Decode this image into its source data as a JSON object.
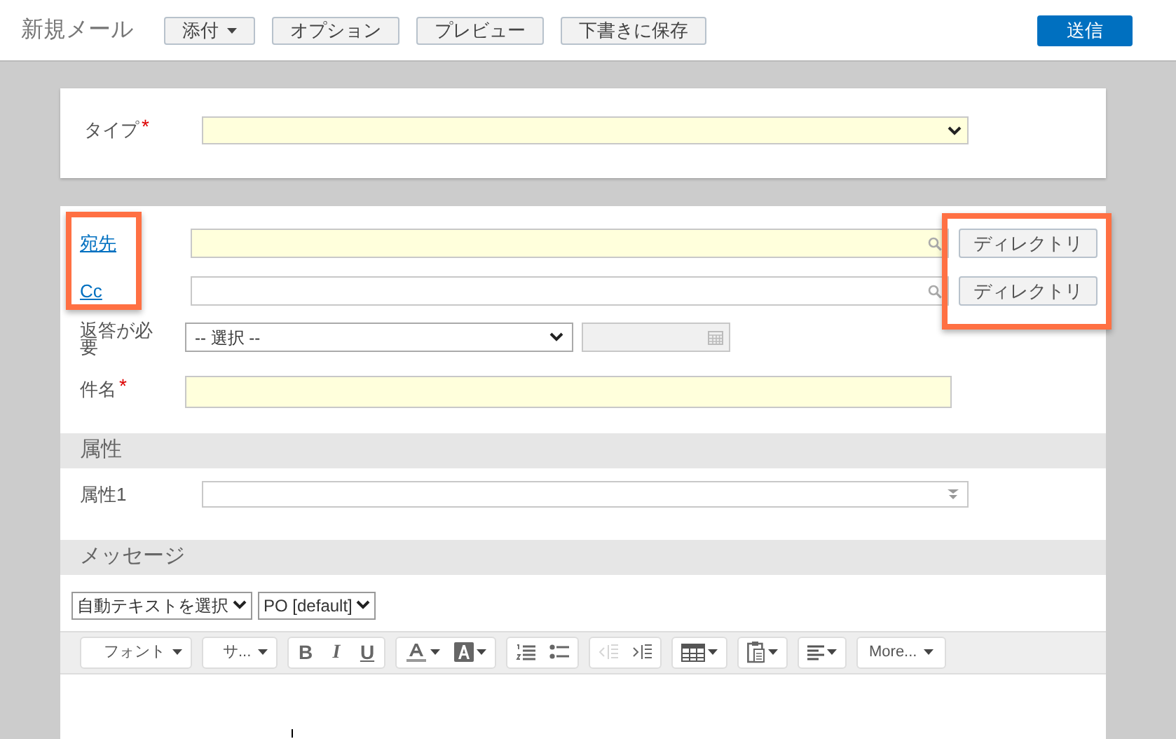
{
  "header": {
    "title": "新規メール",
    "buttons": [
      {
        "label": "添付",
        "dropdown": true
      },
      {
        "label": "オプション",
        "dropdown": false
      },
      {
        "label": "プレビュー",
        "dropdown": false
      },
      {
        "label": "下書きに保存",
        "dropdown": false
      }
    ],
    "send_button": "送信"
  },
  "type_field": {
    "label": "タイプ",
    "required_mark": "*",
    "mandatory": true
  },
  "recipients": [
    {
      "label": "宛先",
      "mandatory": true,
      "directory_button": "ディレクトリ"
    },
    {
      "label": "Cc",
      "mandatory": false,
      "directory_button": "ディレクトリ"
    }
  ],
  "highlight_recipient_labels": true,
  "highlight_directory_buttons": true,
  "reply": {
    "label": "返答が必要",
    "select": "-- 選択 --",
    "date_disabled": true
  },
  "subject": {
    "label": "件名",
    "required_mark": "*",
    "mandatory": true
  },
  "attributes": {
    "heading": "属性",
    "items": [
      {
        "label": "属性1"
      }
    ]
  },
  "message": {
    "heading": "メッセージ",
    "autotext_select": "自動テキストを選択",
    "template_select": "PO [default]",
    "toolbar": [
      [
        {
          "kind": "dropdown",
          "label": "フォント"
        }
      ],
      [
        {
          "kind": "dropdown",
          "label": "サ..."
        }
      ],
      [
        {
          "kind": "bold",
          "label": "B"
        },
        {
          "kind": "italic",
          "label": "I"
        },
        {
          "kind": "underline",
          "label": "U"
        }
      ],
      [
        {
          "kind": "fontcolor",
          "disabled": false
        },
        {
          "kind": "highlight",
          "disabled": false
        }
      ],
      [
        {
          "kind": "numbered",
          "disabled": false
        },
        {
          "kind": "bullets",
          "disabled": false
        }
      ],
      [
        {
          "kind": "outdent",
          "disabled": true
        },
        {
          "kind": "indent",
          "disabled": false
        }
      ],
      [
        {
          "kind": "table",
          "disabled": false
        }
      ],
      [
        {
          "kind": "paste",
          "disabled": false
        }
      ],
      [
        {
          "kind": "align",
          "disabled": false
        }
      ],
      [
        {
          "kind": "dropdown",
          "label": "More..."
        }
      ]
    ]
  }
}
